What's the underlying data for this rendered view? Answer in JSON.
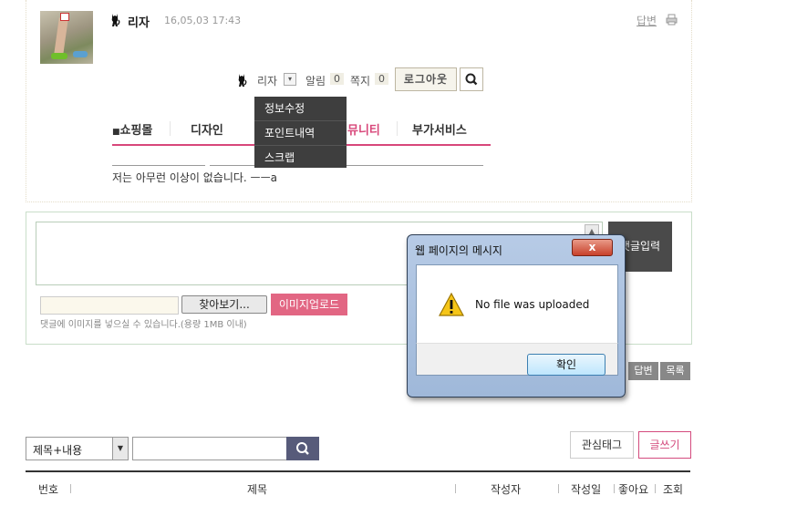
{
  "post": {
    "author": "리자",
    "date": "16,05,03 17:43",
    "reply_link": "답변",
    "content": "저는 아무런 이상이 없습니다. ㅡㅡa"
  },
  "userbar": {
    "username": "리자",
    "dropdown_glyph": "▾",
    "alarm_label": "알림",
    "alarm_count": "0",
    "message_label": "쪽지",
    "message_count": "0",
    "logout_label": "로그아웃"
  },
  "user_menu": [
    "정보수정",
    "포인트내역",
    "스크랩"
  ],
  "nav": {
    "items": [
      "쇼핑몰",
      "디자인",
      "커뮤니티",
      "부가서비스"
    ],
    "visible_tail_3": "뮤니티",
    "active_color": "#d8477a"
  },
  "comment": {
    "submit_label": "댓글입력",
    "browse_label": "찾아보기...",
    "upload_label": "이미지업로드",
    "upload_note": "댓글에 이미지를 넣으실 수 있습니다.(용량 1MB 이내)"
  },
  "actions": {
    "reply_label": "답변",
    "list_label": "목록"
  },
  "search": {
    "select_value": "제목+내용",
    "tag_label": "관심태그",
    "write_label": "글쓰기"
  },
  "table_headers": [
    "번호",
    "제목",
    "작성자",
    "작성일",
    "좋아요",
    "조회"
  ],
  "dialog": {
    "title": "웹 페이지의 메시지",
    "close_glyph": "x",
    "message": "No file was uploaded",
    "ok_label": "확인"
  },
  "colors": {
    "accent_pink": "#d8477a",
    "upload_pink": "#e26683",
    "dark_button": "#4a4a4a",
    "search_button": "#575b7a"
  }
}
